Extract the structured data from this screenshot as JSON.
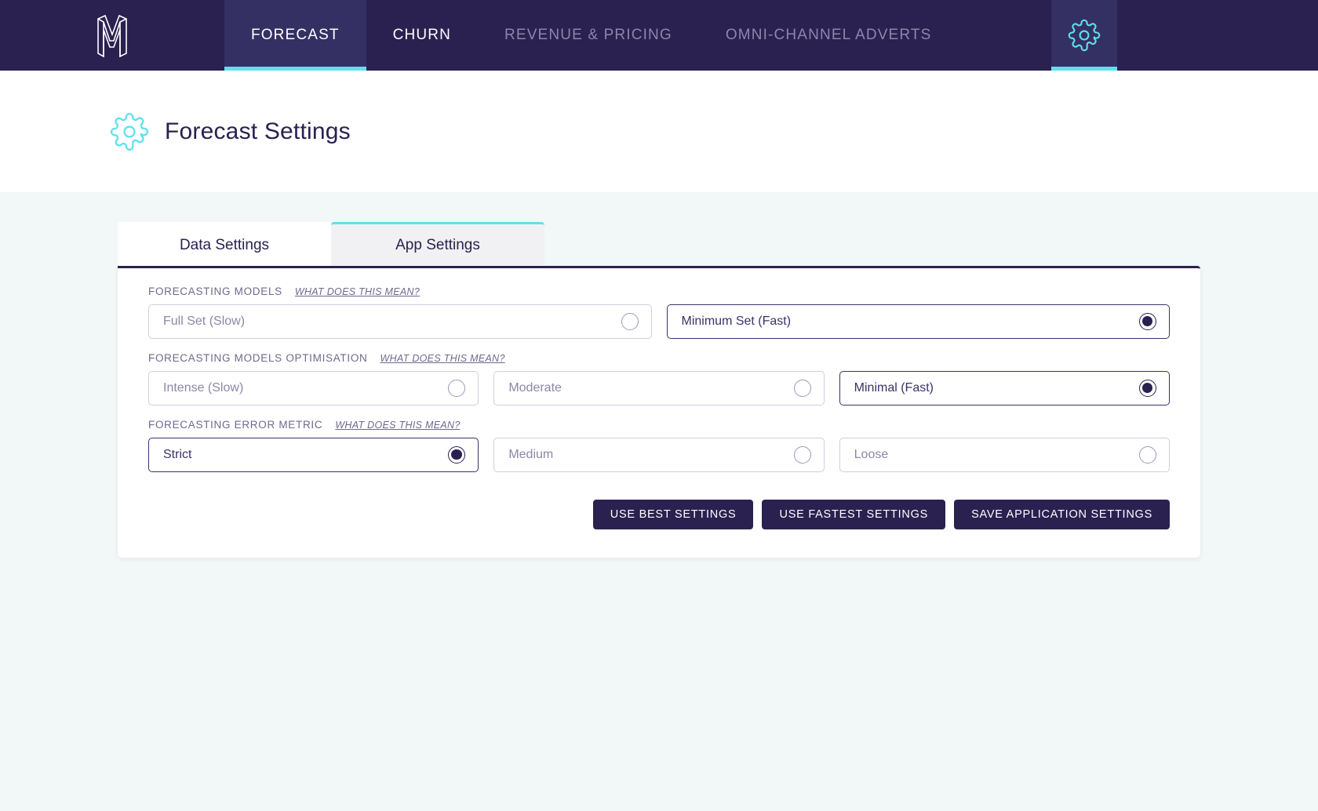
{
  "nav": {
    "logo_name": "stacked-m-logo",
    "items": [
      {
        "label": "FORECAST",
        "state": "active"
      },
      {
        "label": "CHURN",
        "state": "bright"
      },
      {
        "label": "REVENUE & PRICING",
        "state": "dim"
      },
      {
        "label": "OMNI-CHANNEL ADVERTS",
        "state": "dim"
      }
    ],
    "settings_icon": "gear-icon",
    "accent_color": "#5fe1ef",
    "bar_color": "#2a2150",
    "active_tab_color": "#353063"
  },
  "header": {
    "icon": "gear-icon",
    "title": "Forecast Settings"
  },
  "tabs": [
    {
      "label": "Data Settings",
      "active": true
    },
    {
      "label": "App Settings",
      "active": false
    }
  ],
  "sections": [
    {
      "label": "FORECASTING MODELS",
      "help": "WHAT DOES THIS MEAN?",
      "options": [
        {
          "label": "Full Set (Slow)",
          "selected": false
        },
        {
          "label": "Minimum Set (Fast)",
          "selected": true
        }
      ]
    },
    {
      "label": "FORECASTING MODELS OPTIMISATION",
      "help": "WHAT DOES THIS MEAN?",
      "options": [
        {
          "label": "Intense (Slow)",
          "selected": false
        },
        {
          "label": "Moderate",
          "selected": false
        },
        {
          "label": "Minimal (Fast)",
          "selected": true
        }
      ]
    },
    {
      "label": "FORECASTING ERROR METRIC",
      "help": "WHAT DOES THIS MEAN?",
      "options": [
        {
          "label": "Strict",
          "selected": true
        },
        {
          "label": "Medium",
          "selected": false
        },
        {
          "label": "Loose",
          "selected": false
        }
      ]
    }
  ],
  "buttons": [
    {
      "label": "USE BEST SETTINGS"
    },
    {
      "label": "USE FASTEST SETTINGS"
    },
    {
      "label": "SAVE APPLICATION SETTINGS"
    }
  ],
  "colors": {
    "page_background": "#f2f8f7",
    "card_background": "#ffffff",
    "primary": "#2a2150",
    "accent": "#5fe1ef"
  }
}
